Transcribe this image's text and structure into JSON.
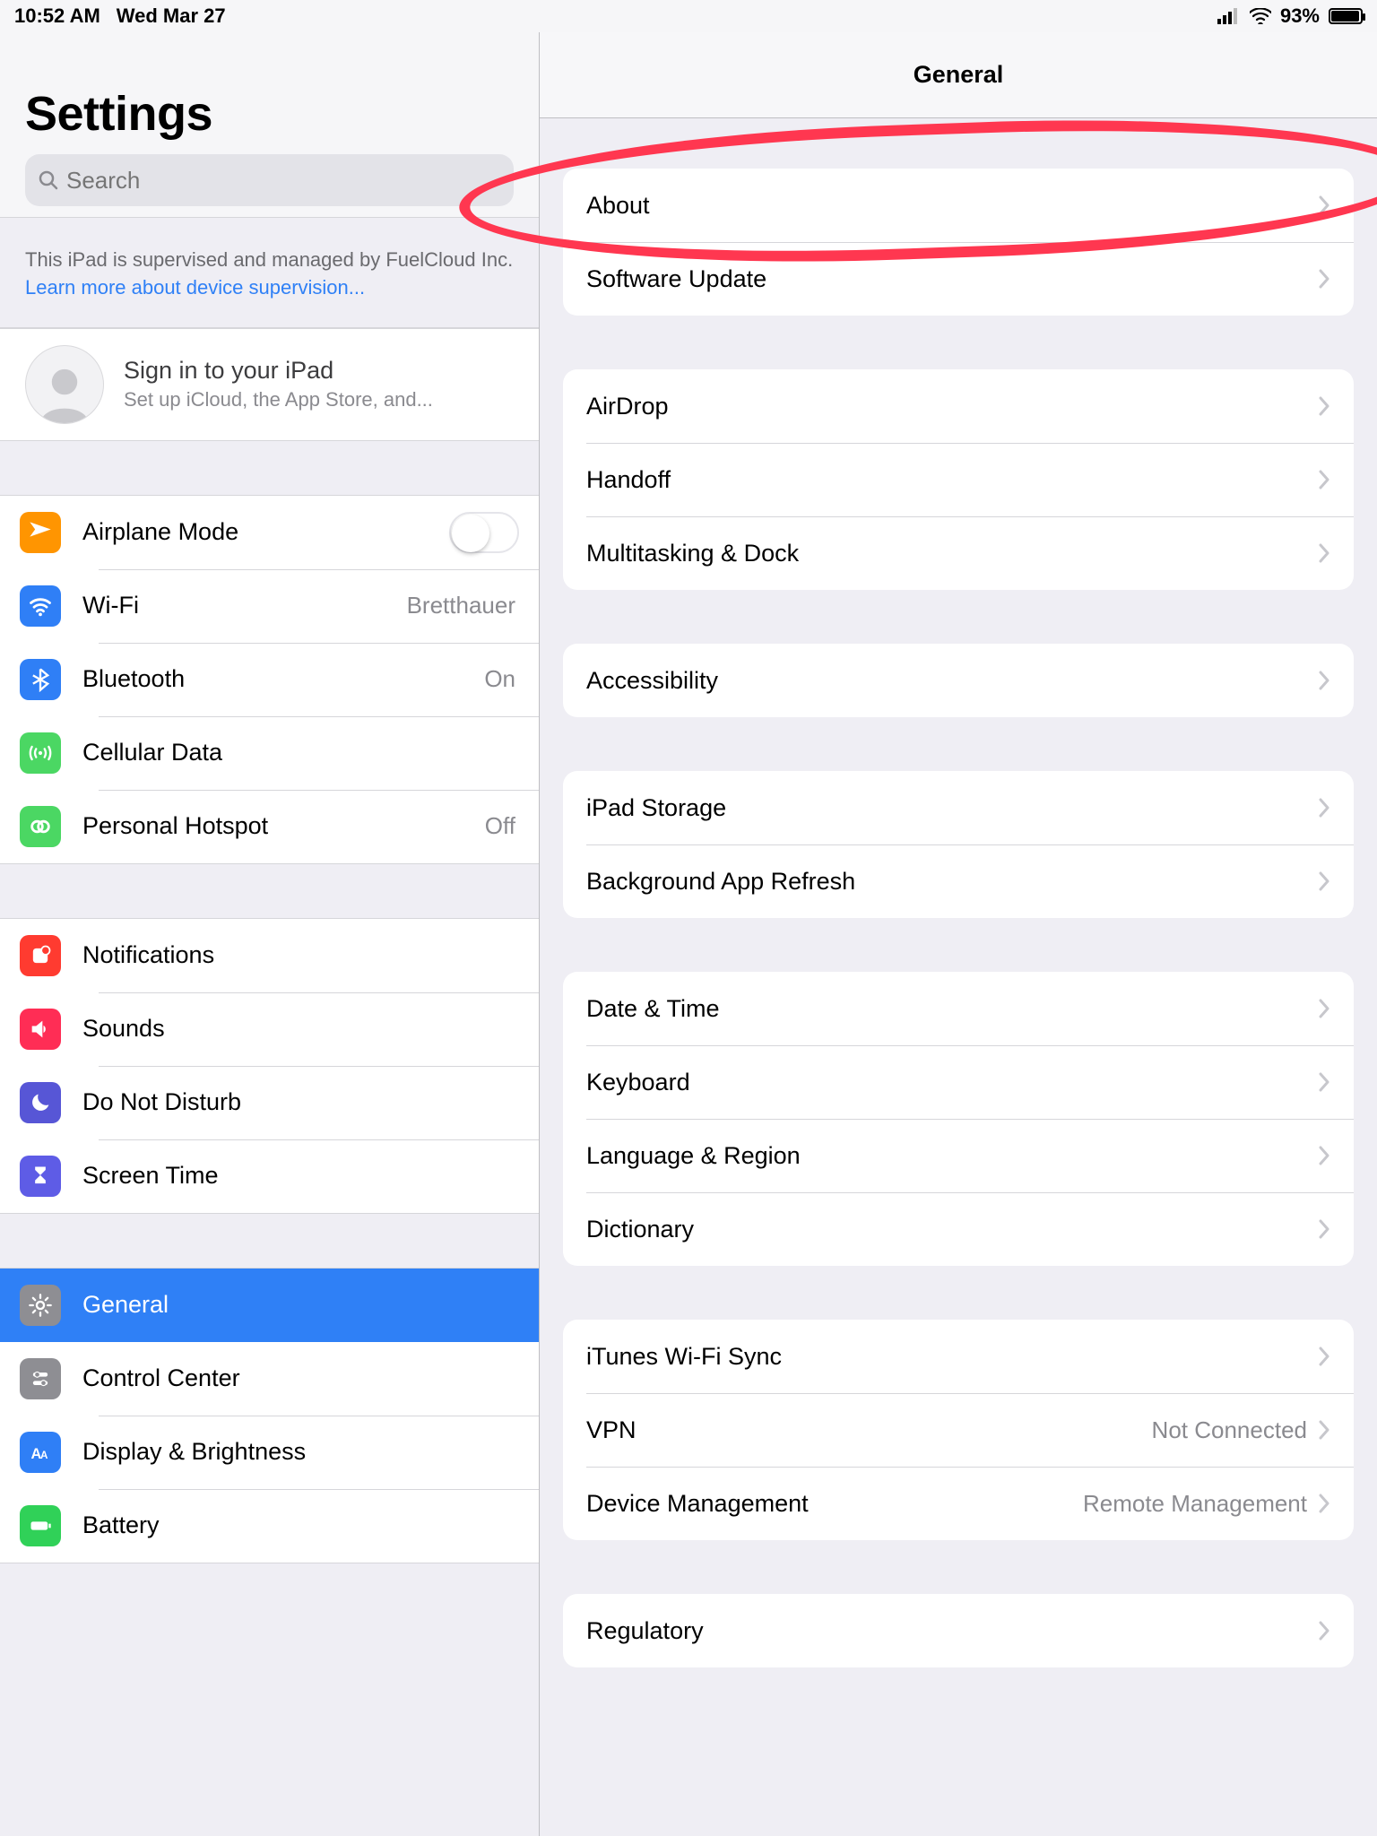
{
  "statusbar": {
    "time": "10:52 AM",
    "date": "Wed Mar 27",
    "battery_pct": "93%"
  },
  "sidebar": {
    "title": "Settings",
    "search_placeholder": "Search",
    "supervise_text": "This iPad is supervised and managed by FuelCloud Inc. ",
    "supervise_link": "Learn more about device supervision...",
    "account_title": "Sign in to your iPad",
    "account_sub": "Set up iCloud, the App Store, and...",
    "items": {
      "airplane": "Airplane Mode",
      "wifi": "Wi-Fi",
      "wifi_value": "Bretthauer",
      "bluetooth": "Bluetooth",
      "bluetooth_value": "On",
      "cellular": "Cellular Data",
      "hotspot": "Personal Hotspot",
      "hotspot_value": "Off",
      "notifications": "Notifications",
      "sounds": "Sounds",
      "dnd": "Do Not Disturb",
      "screentime": "Screen Time",
      "general": "General",
      "control": "Control Center",
      "display": "Display & Brightness",
      "battery": "Battery"
    }
  },
  "detail": {
    "title": "General",
    "groups": [
      {
        "rows": [
          {
            "label": "About"
          },
          {
            "label": "Software Update"
          }
        ]
      },
      {
        "rows": [
          {
            "label": "AirDrop"
          },
          {
            "label": "Handoff"
          },
          {
            "label": "Multitasking & Dock"
          }
        ]
      },
      {
        "rows": [
          {
            "label": "Accessibility"
          }
        ]
      },
      {
        "rows": [
          {
            "label": "iPad Storage"
          },
          {
            "label": "Background App Refresh"
          }
        ]
      },
      {
        "rows": [
          {
            "label": "Date & Time"
          },
          {
            "label": "Keyboard"
          },
          {
            "label": "Language & Region"
          },
          {
            "label": "Dictionary"
          }
        ]
      },
      {
        "rows": [
          {
            "label": "iTunes Wi-Fi Sync"
          },
          {
            "label": "VPN",
            "value": "Not Connected"
          },
          {
            "label": "Device Management",
            "value": "Remote Management"
          }
        ]
      },
      {
        "rows": [
          {
            "label": "Regulatory"
          }
        ]
      }
    ]
  }
}
